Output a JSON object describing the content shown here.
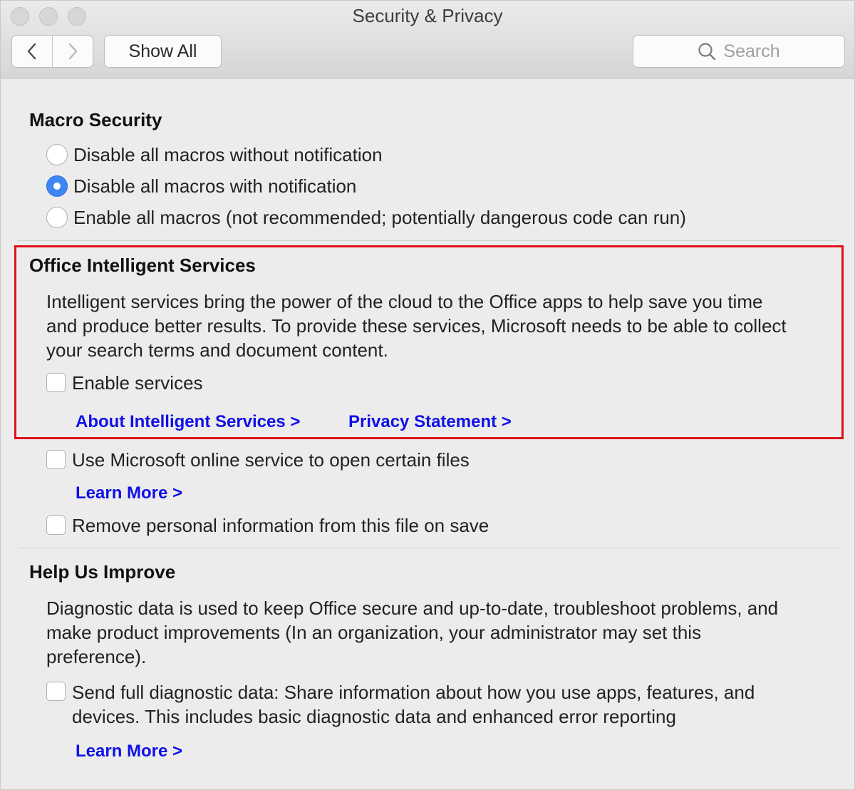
{
  "window": {
    "title": "Security & Privacy"
  },
  "toolbar": {
    "show_all_label": "Show All",
    "search_placeholder": "Search"
  },
  "icons": [
    "back-chevron-icon",
    "forward-chevron-icon",
    "search-icon"
  ],
  "macro_security": {
    "heading": "Macro Security",
    "options": [
      {
        "label": "Disable all macros without notification",
        "selected": false
      },
      {
        "label": "Disable all macros with notification",
        "selected": true
      },
      {
        "label": "Enable all macros (not recommended; potentially dangerous code can run)",
        "selected": false
      }
    ]
  },
  "intelligent_services": {
    "heading": "Office Intelligent Services",
    "description_lines": [
      "Intelligent services bring the power of the cloud to the Office apps to help save you time",
      "and produce better results. To provide these services, Microsoft needs to be able to collect",
      "your search terms and document content."
    ],
    "enable_label": "Enable services",
    "enable_checked": false,
    "about_link": "About Intelligent Services >",
    "privacy_link": "Privacy Statement >",
    "highlight_color": "#e0101a"
  },
  "online_service": {
    "label": "Use Microsoft online service to open certain files",
    "checked": false,
    "learn_more": "Learn More >"
  },
  "remove_personal": {
    "label": "Remove personal information from this file on save",
    "checked": false
  },
  "help_improve": {
    "heading": "Help Us Improve",
    "description_lines": [
      "Diagnostic data is used to keep Office secure and up-to-date, troubleshoot problems, and",
      "make product improvements (In an organization, your administrator may set this",
      "preference)."
    ],
    "send_label_lines": [
      "Send full diagnostic data: Share information about how you use apps, features, and",
      "devices. This includes basic diagnostic data and enhanced error reporting"
    ],
    "send_checked": false,
    "learn_more": "Learn More >"
  },
  "colors": {
    "link": "#1010e8",
    "accent": "#3f86f5",
    "background": "#ececec"
  }
}
